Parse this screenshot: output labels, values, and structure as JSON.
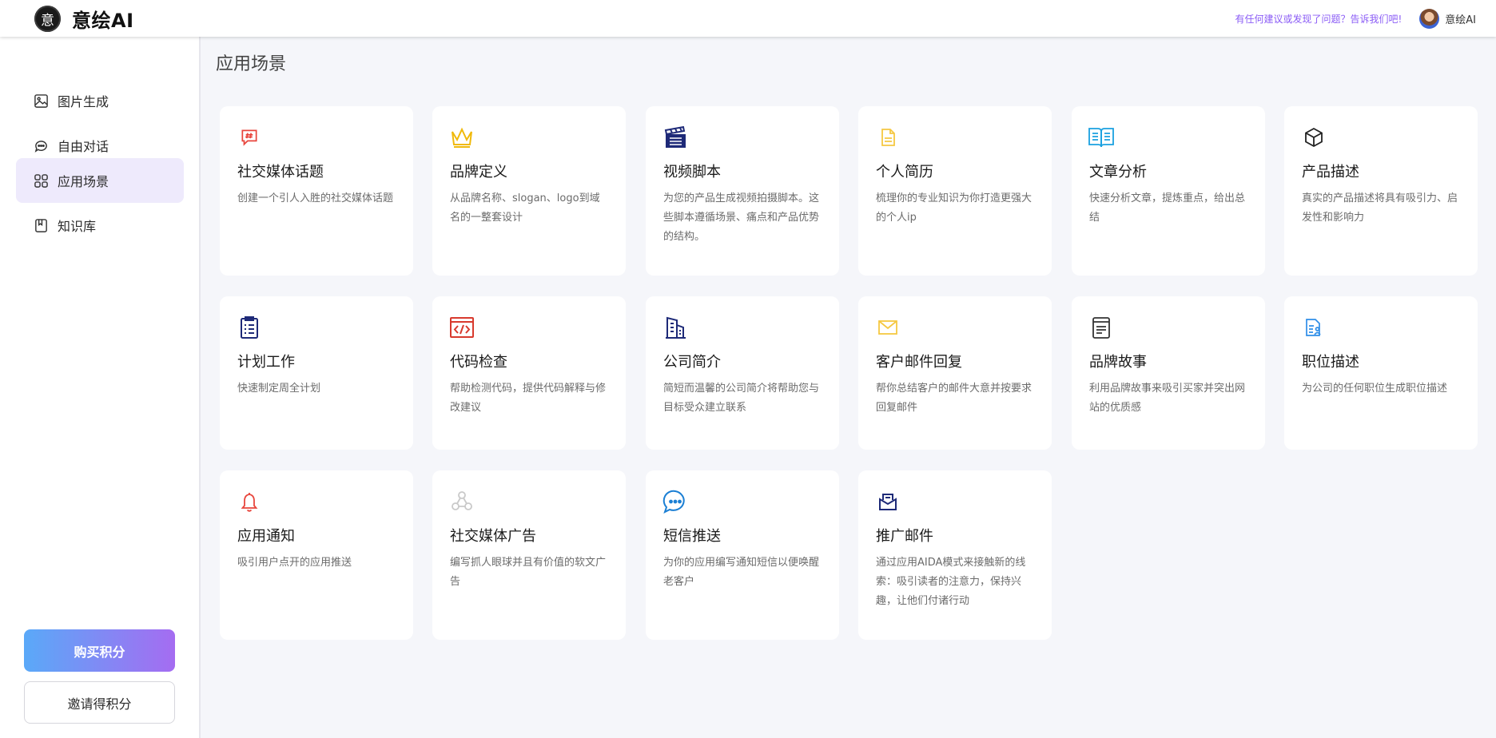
{
  "header": {
    "brand_logo_char": "意",
    "brand_name": "意绘AI",
    "feedback_text": "有任何建议或发现了问题？告诉我们吧!",
    "username": "意绘AI"
  },
  "sidebar": {
    "items": [
      {
        "label": "图片生成",
        "icon": "image-icon"
      },
      {
        "label": "自由对话",
        "icon": "chat-icon"
      },
      {
        "label": "应用场景",
        "icon": "grid-icon",
        "active": true
      },
      {
        "label": "知识库",
        "icon": "book-icon"
      }
    ],
    "buy_points_label": "购买积分",
    "invite_points_label": "邀请得积分"
  },
  "main": {
    "title": "应用场景",
    "cards": [
      {
        "title": "社交媒体话题",
        "desc": "创建一个引人入胜的社交媒体话题",
        "icon": "hashtag-chat-icon",
        "color": "#e8453c"
      },
      {
        "title": "品牌定义",
        "desc": "从品牌名称、slogan、logo到域名的一整套设计",
        "icon": "crown-icon",
        "color": "#f0b90b"
      },
      {
        "title": "视频脚本",
        "desc": "为您的产品生成视频拍摄脚本。这些脚本遵循场景、痛点和产品优势的结构。",
        "icon": "clapperboard-icon",
        "color": "#1e2a78"
      },
      {
        "title": "个人简历",
        "desc": "梳理你的专业知识为你打造更强大的个人ip",
        "icon": "document-icon",
        "color": "#f5c842"
      },
      {
        "title": "文章分析",
        "desc": "快速分析文章，提炼重点，给出总结",
        "icon": "open-book-icon",
        "color": "#1aa1e0"
      },
      {
        "title": "产品描述",
        "desc": "真实的产品描述将具有吸引力、启发性和影响力",
        "icon": "cube-icon",
        "color": "#222222"
      },
      {
        "title": "计划工作",
        "desc": "快速制定周全计划",
        "icon": "clipboard-list-icon",
        "color": "#1e2a78"
      },
      {
        "title": "代码检查",
        "desc": "帮助检测代码，提供代码解释与修改建议",
        "icon": "code-window-icon",
        "color": "#d83a2e"
      },
      {
        "title": "公司简介",
        "desc": "简短而温馨的公司简介将帮助您与目标受众建立联系",
        "icon": "building-icon",
        "color": "#1e2a78"
      },
      {
        "title": "客户邮件回复",
        "desc": "帮你总结客户的邮件大意并按要求回复邮件",
        "icon": "envelope-icon",
        "color": "#f5c842"
      },
      {
        "title": "品牌故事",
        "desc": "利用品牌故事来吸引买家并突出网站的优质感",
        "icon": "notebook-icon",
        "color": "#333333"
      },
      {
        "title": "职位描述",
        "desc": "为公司的任何职位生成职位描述",
        "icon": "id-document-icon",
        "color": "#2f8ee8"
      },
      {
        "title": "应用通知",
        "desc": "吸引用户点开的应用推送",
        "icon": "bell-icon",
        "color": "#e8453c"
      },
      {
        "title": "社交媒体广告",
        "desc": "编写抓人眼球并且有价值的软文广告",
        "icon": "share-icon",
        "color": "#c9c9c9"
      },
      {
        "title": "短信推送",
        "desc": "为你的应用编写通知短信以便唤醒老客户",
        "icon": "message-bubble-icon",
        "color": "#1b7fd4"
      },
      {
        "title": "推广邮件",
        "desc": "通过应用AIDA模式来接触新的线索：吸引读者的注意力，保持兴趣，让他们付诸行动",
        "icon": "mail-inbox-icon",
        "color": "#1e2a78"
      }
    ]
  }
}
